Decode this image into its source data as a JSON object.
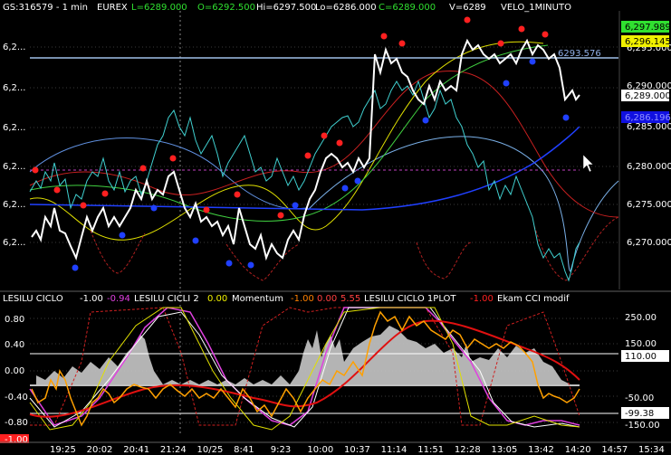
{
  "header": {
    "symbol": "GS:316579 - 1 min",
    "exchange": "EUREX",
    "last": "L=6289.000",
    "open": "O=6292.500",
    "high": "Hi=6297.500",
    "low": "Lo=6286.000",
    "close": "C=6289.000",
    "volume": "V=6289",
    "indicator": "VELO_1MINUTO"
  },
  "price_axis": {
    "ticks": [
      "6,295.000",
      "6,290.000",
      "6,285.000",
      "6,280.000",
      "6,275.000",
      "6,270.000"
    ],
    "left_ticks": [
      "6,2...",
      "6,2...",
      "6,2...",
      "6,2...",
      "6,2...",
      "6,2..."
    ]
  },
  "price_tags": {
    "upper_green": "6,297.989",
    "upper_yellow": "6,296.145",
    "last_price": "6,289.000",
    "blue_tag": "6,286.196"
  },
  "horizontal_line_label": "6293.576",
  "lower_header": {
    "i1_name": "LESILU CICLO",
    "i1_val": "-1.00",
    "i1_val2": "-0.94",
    "i2_name": "LESILU CICLI 2",
    "i2_val": "0.00",
    "i3_name": "Momentum",
    "i3_val": "-1.00",
    "i3_val2": "0.00",
    "i3_val3": "5.55",
    "i4_name": "LESILU CICLO 1PLOT",
    "i4_val": "-1.00",
    "i5_name": "Ekam CCI modif"
  },
  "lower_left_axis": [
    "0.80",
    "0.40",
    "0.00",
    "-0.40",
    "-0.80",
    "-1.00"
  ],
  "lower_right_axis": [
    "250.00",
    "150.00",
    "110.00",
    "-50.00",
    "-99.38",
    "-150.00"
  ],
  "time_axis": [
    "19:25",
    "20:02",
    "20:41",
    "21:24",
    "10/25",
    "8:41",
    "9:23",
    "10:00",
    "10:37",
    "11:14",
    "11:51",
    "12:28",
    "13:05",
    "13:42",
    "14:20",
    "14:57",
    "15:34"
  ],
  "colors": {
    "background": "#000000",
    "price_line": "#ffffff",
    "cyan_series": "#40d0d0",
    "red_curve": "#d02020",
    "yellow_curve": "#e0e000",
    "green_curve": "#40e040",
    "blue_curve": "#2040ff",
    "light_blue_curve": "#6090e0",
    "magenta_dashed": "#c040c0",
    "dot_red": "#ff2020",
    "dot_blue": "#2040ff",
    "grey_histogram": "#c8c8c8",
    "orange_line": "#ff8000"
  }
}
